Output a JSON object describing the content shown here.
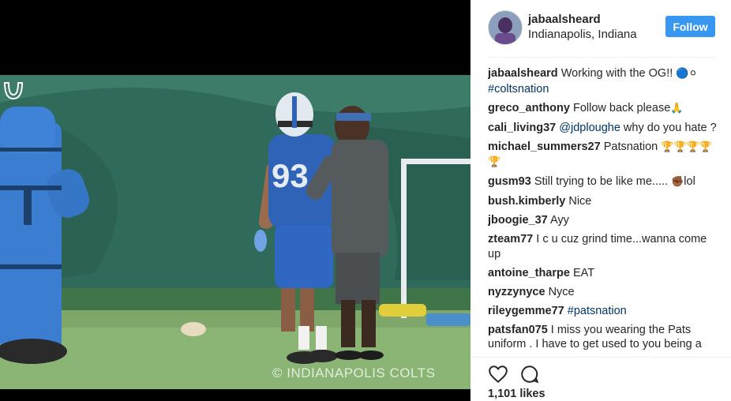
{
  "post": {
    "username": "jabaalsheard",
    "location": "Indianapolis, Indiana",
    "follow_label": "Follow",
    "watermark": "© INDIANAPOLIS COLTS",
    "jersey_number": "93",
    "likes": "1,101 likes"
  },
  "comments": [
    {
      "user": "jabaalsheard",
      "text": "Working with the OG!! ",
      "emoji": "🔵⚪",
      "hashtag": "#coltsnation"
    },
    {
      "user": "greco_anthony",
      "text": "Follow back please",
      "emoji": "🙏"
    },
    {
      "user": "cali_living37",
      "mention": "@jdploughe",
      "text": " why do you hate ?"
    },
    {
      "user": "michael_summers27",
      "text": "Patsnation ",
      "emoji": "🏆🏆🏆🏆🏆"
    },
    {
      "user": "gusm93",
      "text": "Still trying to be like me..... ",
      "emoji": "✊🏾",
      "text2": "lol"
    },
    {
      "user": "bush.kimberly",
      "text": "Nice"
    },
    {
      "user": "jboogie_37",
      "text": "Ayy"
    },
    {
      "user": "zteam77",
      "text": "I c u cuz grind time...wanna come up"
    },
    {
      "user": "antoine_tharpe",
      "text": "EAT"
    },
    {
      "user": "nyzzynyce",
      "text": "Nyce"
    },
    {
      "user": "rileygemme77",
      "hashtag": "#patsnation"
    },
    {
      "user": "patsfan075",
      "text": "I miss you wearing the Pats uniform . I have to get used to you being a"
    }
  ],
  "icons": [
    "heart-icon",
    "comment-icon"
  ],
  "colors": {
    "follow_button": "#3897f0",
    "link": "#003569",
    "text": "#262626"
  }
}
